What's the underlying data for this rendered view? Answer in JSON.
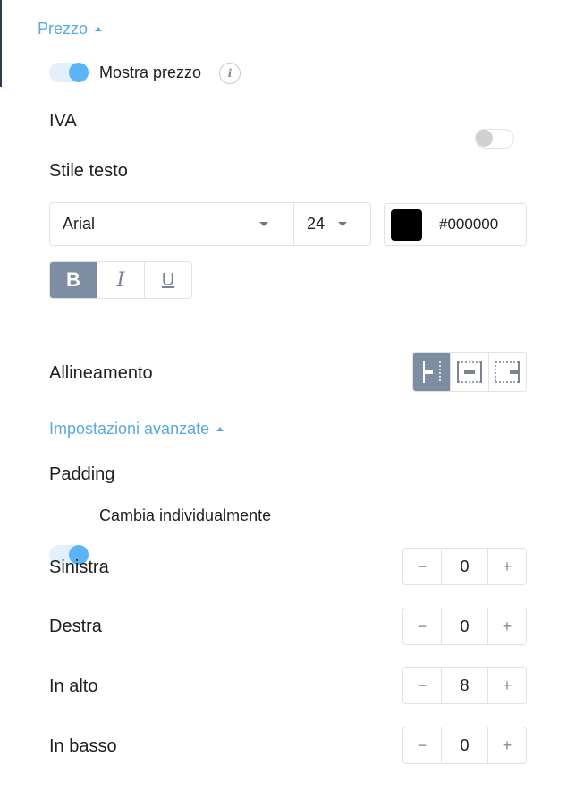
{
  "price_section": {
    "toggle_label": "Prezzo",
    "show_price_label": "Mostra prezzo",
    "show_price_on": true,
    "info_icon_glyph": "i",
    "vat_label": "IVA",
    "vat_on": false
  },
  "text_style": {
    "heading": "Stile testo",
    "font_family": "Arial",
    "font_size": "24",
    "color_hex": "#000000",
    "bold_glyph": "B",
    "italic_glyph": "I",
    "underline_glyph": "U",
    "active_style": "bold"
  },
  "alignment": {
    "label": "Allineamento",
    "options": [
      "left-icon",
      "center-icon",
      "right-icon"
    ],
    "selected": "left"
  },
  "advanced": {
    "toggle_label": "Impostazioni avanzate",
    "padding_heading": "Padding",
    "individual_label": "Cambia individualmente",
    "individual_on": true,
    "minus_glyph": "−",
    "plus_glyph": "+",
    "rows": [
      {
        "label": "Sinistra",
        "value": "0"
      },
      {
        "label": "Destra",
        "value": "0"
      },
      {
        "label": "In alto",
        "value": "8"
      },
      {
        "label": "In basso",
        "value": "0"
      }
    ]
  },
  "colors": {
    "accent": "#5aa9e6",
    "toggle_knob": "#5ab4f5",
    "active_button": "#7d8ea3",
    "border": "#e2e2e2"
  }
}
